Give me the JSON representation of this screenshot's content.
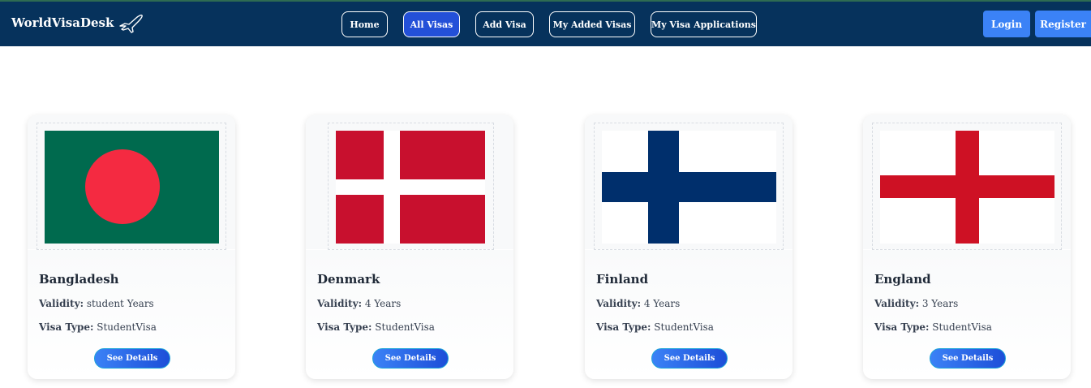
{
  "brand": {
    "name": "WorldVisaDesk",
    "icon": "airplane-icon"
  },
  "nav": {
    "items": [
      {
        "label": "Home"
      },
      {
        "label": "All Visas",
        "active": true
      },
      {
        "label": "Add Visa"
      },
      {
        "label": "My Added Visas"
      },
      {
        "label": "My Visa Applications"
      }
    ],
    "login": "Login",
    "register": "Register"
  },
  "labels": {
    "validity": "Validity:",
    "visa_type": "Visa Type:",
    "details_button": "See Details"
  },
  "cards": [
    {
      "country": "Bangladesh",
      "validity": "student Years",
      "visa_type": "StudentVisa",
      "flag": "bangladesh-flag"
    },
    {
      "country": "Denmark",
      "validity": "4 Years",
      "visa_type": "StudentVisa",
      "flag": "denmark-flag"
    },
    {
      "country": "Finland",
      "validity": "4 Years",
      "visa_type": "StudentVisa",
      "flag": "finland-flag"
    },
    {
      "country": "England",
      "validity": "3 Years",
      "visa_type": "StudentVisa",
      "flag": "england-flag"
    }
  ],
  "colors": {
    "navbar": "#06325c",
    "active_nav": "#2350d8",
    "auth_button": "#3b82f6"
  }
}
